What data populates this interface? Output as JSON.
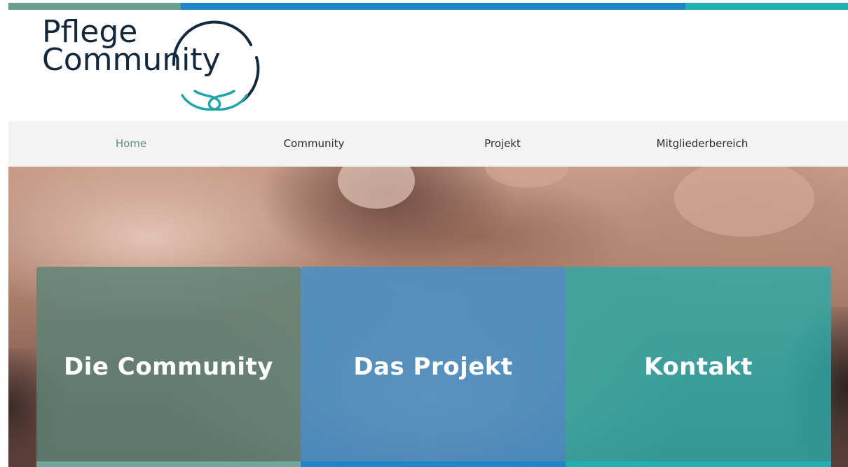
{
  "brand": {
    "line1": "Pflege",
    "line2": "Community",
    "colors": {
      "dark": "#14283c",
      "teal": "#1fa5a8",
      "sage": "#6b9e93",
      "blue": "#1f86cc",
      "cyan": "#1fb0b2"
    }
  },
  "nav": {
    "items": [
      {
        "label": "Home",
        "active": true
      },
      {
        "label": "Community",
        "active": false
      },
      {
        "label": "Projekt",
        "active": false
      },
      {
        "label": "Mitgliederbereich",
        "active": false
      }
    ]
  },
  "hero": {
    "tiles": [
      {
        "label": "Die Community"
      },
      {
        "label": "Das Projekt"
      },
      {
        "label": "Kontakt"
      }
    ]
  }
}
